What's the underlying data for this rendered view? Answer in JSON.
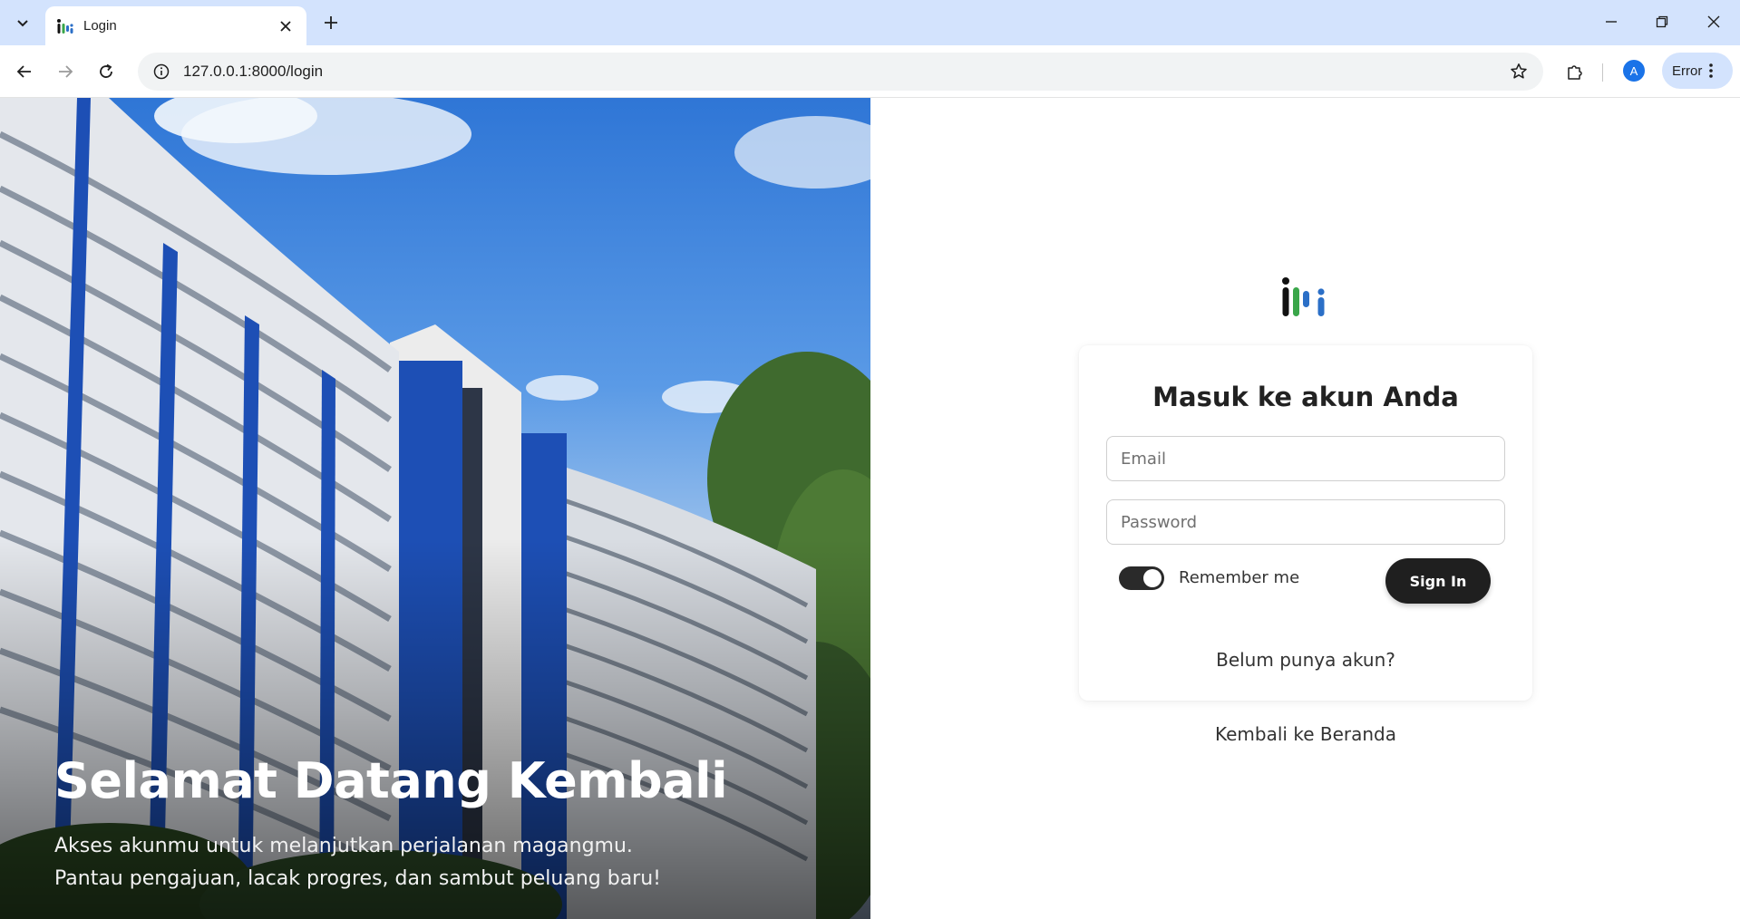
{
  "browser": {
    "tab_title": "Login",
    "url": "127.0.0.1:8000/login",
    "profile_initial": "A",
    "error_label": "Error"
  },
  "hero": {
    "title": "Selamat Datang Kembali",
    "subtitle_line1": "Akses akunmu untuk melanjutkan perjalanan magangmu.",
    "subtitle_line2": "Pantau pengajuan, lacak progres, dan sambut peluang baru!"
  },
  "login": {
    "title": "Masuk ke akun Anda",
    "email_placeholder": "Email",
    "password_placeholder": "Password",
    "remember_label": "Remember me",
    "remember_checked": true,
    "signin_label": "Sign In",
    "register_link": "Belum punya akun?",
    "home_link": "Kembali ke Beranda"
  },
  "colors": {
    "tabbar": "#d3e3fd",
    "button_dark": "#1f1f1f",
    "logo_black": "#111111",
    "logo_green": "#3aa64a",
    "logo_blue": "#2b6fc7"
  },
  "icons": [
    "tab-search-icon",
    "favicon-icon",
    "close-icon",
    "plus-icon",
    "minimize-icon",
    "restore-icon",
    "window-close-icon",
    "back-icon",
    "forward-icon",
    "reload-icon",
    "site-info-icon",
    "bookmark-star-icon",
    "extensions-icon",
    "more-vert-icon"
  ]
}
